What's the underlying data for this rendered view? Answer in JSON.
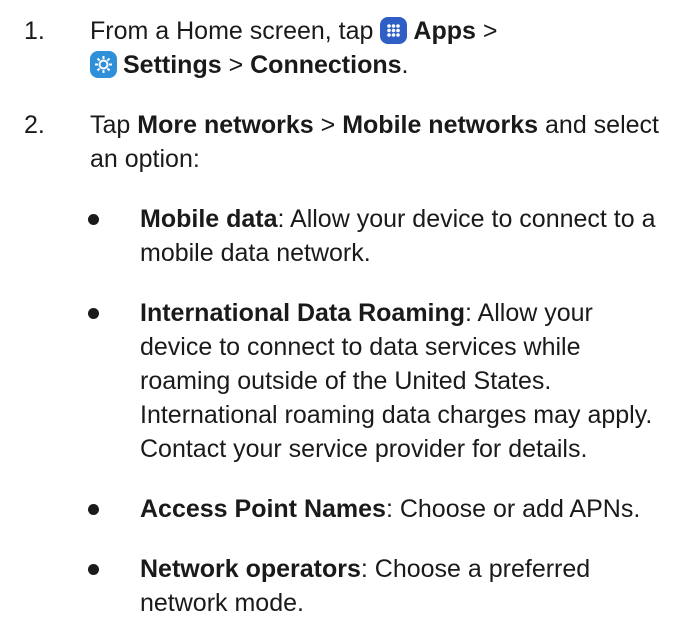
{
  "steps": [
    {
      "number": "1.",
      "line1_prefix": "From a Home screen, tap",
      "apps": "Apps",
      "sep1": " >",
      "settings": "Settings",
      "sep2": " > ",
      "connections": "Connections",
      "period": "."
    },
    {
      "number": "2.",
      "prefix": "Tap ",
      "more_networks": "More networks",
      "sep": " > ",
      "mobile_networks": "Mobile networks",
      "suffix": " and select an option:"
    }
  ],
  "options": [
    {
      "title": "Mobile data",
      "text": ": Allow your device to connect to a mobile data network."
    },
    {
      "title": "International Data Roaming",
      "text": ": Allow your device to connect to data services while roaming outside of the United States. International roaming data charges may apply. Contact your service provider for details."
    },
    {
      "title": "Access Point Names",
      "text": ": Choose or add APNs."
    },
    {
      "title": "Network operators",
      "text": ": Choose a preferred network mode."
    }
  ],
  "icons": {
    "apps": "apps-grid-icon",
    "settings": "settings-gear-icon",
    "apps_color": "#2f5ec4",
    "settings_color": "#2f8fd9"
  }
}
